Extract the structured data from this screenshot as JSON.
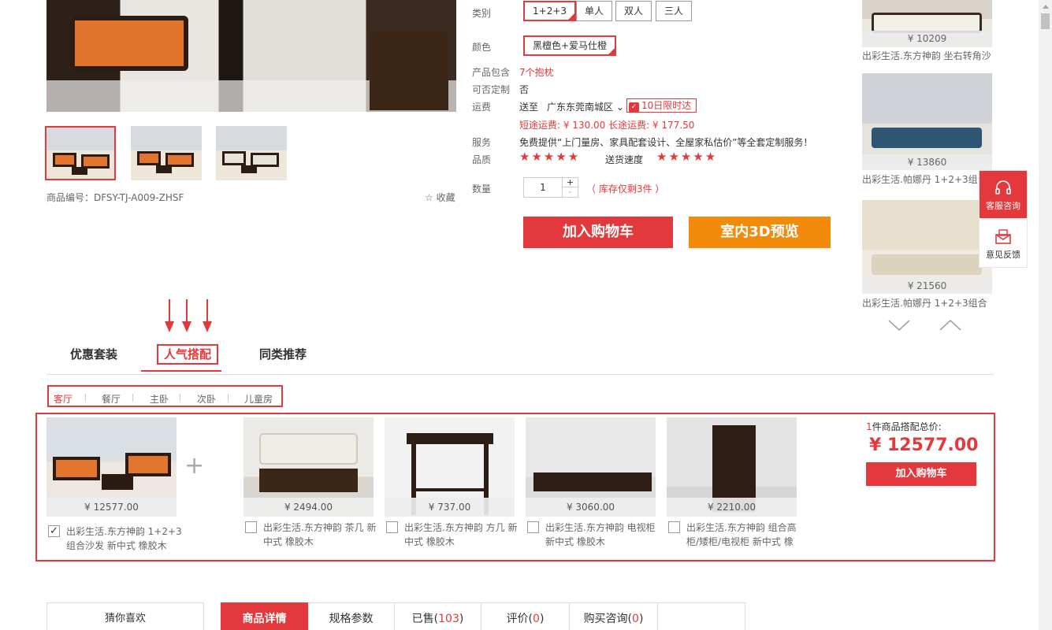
{
  "gallery": {
    "sku_label": "商品编号：DFSY-TJ-A009-ZHSF",
    "favorite_label": "收藏"
  },
  "attributes": {
    "category_label": "类别",
    "category_options": [
      "1+2+3",
      "单人",
      "双人",
      "三人"
    ],
    "color_label": "颜色",
    "color_value": "黑檀色+爱马仕橙",
    "includes_label": "产品包含",
    "includes_value": "7个抱枕",
    "custom_label": "可否定制",
    "custom_value": "否",
    "shipping_label": "运费",
    "ship_to_label": "送至",
    "ship_region": "广东东莞南城区",
    "ship_badge": "10日限时达",
    "ship_fee": "短途运费: ¥ 130.00 长途运费: ¥ 177.50",
    "service_label": "服务",
    "service_value": "免费提供“上门量房、家具配套设计、全屋家私估价”等全套定制服务！",
    "quality_label": "品质",
    "quality_stars": "★★★★★",
    "delivery_label": "送货速度",
    "delivery_stars": "★★★★★",
    "qty_label": "数量",
    "qty_value": "1",
    "qty_plus": "+",
    "qty_minus": "-",
    "stock_note": "（ 库存仅剩3件 ）",
    "add_cart": "加入购物车",
    "preview_3d": "室内3D预览"
  },
  "recommend": [
    {
      "price": "¥ 10209",
      "name": "出彩生活.东方神韵 坐右转角沙"
    },
    {
      "price": "¥ 13860",
      "name": "出彩生活.帕娜丹 1+2+3组合"
    },
    {
      "price": "¥ 21560",
      "name": "出彩生活.帕娜丹 1+2+3组合"
    }
  ],
  "side": {
    "service": "客服咨询",
    "feedback": "意见反馈"
  },
  "tabs": [
    "优惠套装",
    "人气搭配",
    "同类推荐"
  ],
  "subtabs": [
    "客厅",
    "餐厅",
    "主卧",
    "次卧",
    "儿童房"
  ],
  "combo": {
    "main": {
      "price": "¥ 12577.00",
      "name": "出彩生活.东方神韵 1+2+3组合沙发 新中式 橡胶木"
    },
    "plus": "+",
    "items": [
      {
        "price": "¥ 2494.00",
        "name": "出彩生活.东方神韵 茶几 新中式 橡胶木"
      },
      {
        "price": "¥ 737.00",
        "name": "出彩生活.东方神韵 方几 新中式 橡胶木"
      },
      {
        "price": "¥ 3060.00",
        "name": "出彩生活.东方神韵 电视柜 新中式 橡胶木"
      },
      {
        "price": "¥ 2210.00",
        "name": "出彩生活.东方神韵 组合高柜/矮柜/电视柜 新中式 橡"
      }
    ],
    "total_count": "1",
    "total_label": "件商品搭配总价:",
    "total_amount": "¥ 12577.00",
    "add_cart": "加入购物车"
  },
  "bottom": {
    "guess": "猜你喜欢",
    "detail": "商品详情",
    "specs": "规格参数",
    "sold_label": "已售(",
    "sold_count": "103",
    "review_label": "评价(",
    "review_count": "0",
    "consult_label": "购买咨询(",
    "consult_count": "0",
    "close_paren": ")"
  },
  "colors": {
    "accent": "#e4393c",
    "orange": "#f28b0c"
  }
}
